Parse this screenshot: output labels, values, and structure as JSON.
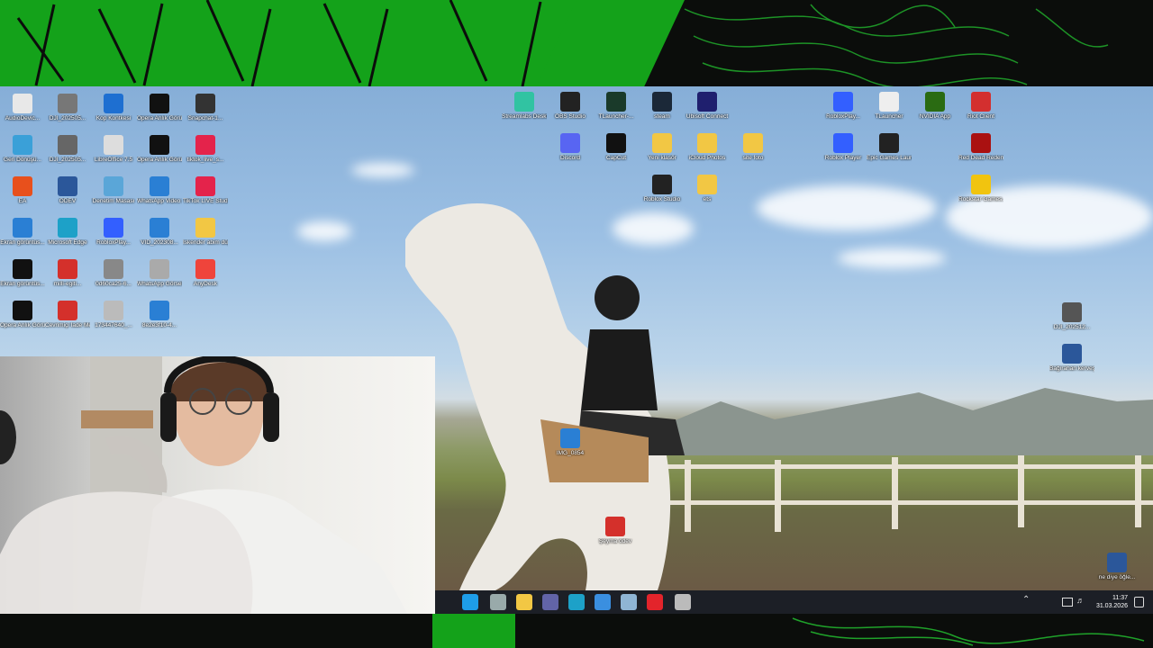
{
  "colors": {
    "accent": "#14a21a",
    "taskbar": "#1c1f26",
    "banner_dark": "#0b0d0b"
  },
  "desktop_icons_left": [
    {
      "label": "AudioDevic...",
      "icon": "audio-file-icon",
      "color": "#e8e8e8"
    },
    {
      "label": "DJI_202505...",
      "icon": "image-thumbnail-icon",
      "color": "#777"
    },
    {
      "label": "Kop Kontkesi",
      "icon": "app-icon",
      "color": "#1e6fd1"
    },
    {
      "label": "Opera Anlık Görüntü_2...",
      "icon": "screenshot-icon",
      "color": "#111"
    },
    {
      "label": "Snapchat-1...",
      "icon": "image-thumbnail-icon",
      "color": "#333"
    },
    {
      "label": "Geri Dönüşü...",
      "icon": "recycle-bin-icon",
      "color": "#3aa0d8"
    },
    {
      "label": "DJI_202505...",
      "icon": "image-thumbnail-icon",
      "color": "#666"
    },
    {
      "label": "LibreOffice 7.5",
      "icon": "libreoffice-icon",
      "color": "#ddd"
    },
    {
      "label": "Opera Anlık Görüntü_2...",
      "icon": "screenshot-icon",
      "color": "#111"
    },
    {
      "label": "tiktok_live_s...",
      "icon": "tiktok-icon",
      "color": "#e4234b"
    },
    {
      "label": "EA",
      "icon": "ea-icon",
      "color": "#e8501c"
    },
    {
      "label": "ÖDEV",
      "icon": "word-doc-icon",
      "color": "#2b579a"
    },
    {
      "label": "Denetim Masası",
      "icon": "control-panel-icon",
      "color": "#5aa6d8"
    },
    {
      "label": "WhatsApp Video 2024-...",
      "icon": "video-file-icon",
      "color": "#2a7fd4"
    },
    {
      "label": "TikTok LIVE Studio",
      "icon": "tiktok-live-icon",
      "color": "#e4234b"
    },
    {
      "label": "Ekran görüntüs...",
      "icon": "image-file-icon",
      "color": "#2a7fd4"
    },
    {
      "label": "Microsoft Edge",
      "icon": "edge-icon",
      "color": "#1da1c8"
    },
    {
      "label": "RobloxPlay...",
      "icon": "roblox-icon",
      "color": "#335fff"
    },
    {
      "label": "VID_202308...",
      "icon": "video-file-icon",
      "color": "#2a7fd4"
    },
    {
      "label": "İskender abim düğ...",
      "icon": "folder-icon",
      "color": "#f2c744"
    },
    {
      "label": "Ekran görüntüs...",
      "icon": "screenshot-icon",
      "color": "#111"
    },
    {
      "label": "milli-egiti...",
      "icon": "pdf-icon",
      "color": "#d4302b"
    },
    {
      "label": "0d60ca25-6...",
      "icon": "image-thumbnail-icon",
      "color": "#888"
    },
    {
      "label": "WhatsApp Görsel 2023...",
      "icon": "image-thumbnail-icon",
      "color": "#aaa"
    },
    {
      "label": "AnyDesk",
      "icon": "anydesk-icon",
      "color": "#ef443b"
    },
    {
      "label": "Opera Anlık Görüntü_20...",
      "icon": "screenshot-icon",
      "color": "#111"
    },
    {
      "label": "Cevrimiçi İade Merkezi",
      "icon": "pdf-icon",
      "color": "#d4302b"
    },
    {
      "label": "173447640_...",
      "icon": "image-thumbnail-icon",
      "color": "#bbb"
    },
    {
      "label": "8e2e3f10-4...",
      "icon": "image-thumbnail-icon",
      "color": "#2a7fd4"
    }
  ],
  "desktop_icons_center": [
    {
      "label": "Streamlabs Desktop",
      "icon": "streamlabs-icon",
      "color": "#31c3a2"
    },
    {
      "label": "OBS Studio",
      "icon": "obs-icon",
      "color": "#222"
    },
    {
      "label": "TLauncher-...",
      "icon": "tlauncher-icon",
      "color": "#1a3a2a"
    },
    {
      "label": "steam",
      "icon": "steam-icon",
      "color": "#1b2838"
    },
    {
      "label": "Ubisoft Connect",
      "icon": "ubisoft-icon",
      "color": "#1f1f6e"
    },
    {
      "label": "Discord",
      "icon": "discord-icon",
      "color": "#5865f2"
    },
    {
      "label": "CapCut",
      "icon": "capcut-icon",
      "color": "#111"
    },
    {
      "label": "Yeni klasör",
      "icon": "folder-icon",
      "color": "#f2c744"
    },
    {
      "label": "iCloud Photos",
      "icon": "folder-icon",
      "color": "#f2c744"
    },
    {
      "label": "site foto",
      "icon": "folder-icon",
      "color": "#f2c744"
    },
    {
      "label": "Roblox Studio",
      "icon": "roblox-studio-icon",
      "color": "#222"
    },
    {
      "label": "ets",
      "icon": "folder-icon",
      "color": "#f2c744"
    },
    {
      "label": "IMG_0854",
      "icon": "image-file-icon",
      "color": "#2a7fd4"
    },
    {
      "label": "Şeyma ödev",
      "icon": "pdf-icon",
      "color": "#d4302b"
    }
  ],
  "desktop_icons_right": [
    {
      "label": "RobloxPlay...",
      "icon": "roblox-icon",
      "color": "#335fff"
    },
    {
      "label": "TLauncher",
      "icon": "file-icon",
      "color": "#eee"
    },
    {
      "label": "NVIDIA App",
      "icon": "nvidia-icon",
      "color": "#2a6b12"
    },
    {
      "label": "Riot Client",
      "icon": "riot-icon",
      "color": "#d32f2f"
    },
    {
      "label": "Roblox Player",
      "icon": "roblox-icon",
      "color": "#335fff"
    },
    {
      "label": "Epic Games Launcher",
      "icon": "epic-icon",
      "color": "#222"
    },
    {
      "label": "Red Dead Redempti...",
      "icon": "rdr-icon",
      "color": "#a11"
    },
    {
      "label": "Rockstar Games...",
      "icon": "rockstar-icon",
      "color": "#f1c40f"
    },
    {
      "label": "DJI_202512...",
      "icon": "image-thumbnail-icon",
      "color": "#555"
    },
    {
      "label": "Bağırahan kerveş Te...",
      "icon": "word-doc-icon",
      "color": "#2b579a"
    },
    {
      "label": "ne diye öğle...",
      "icon": "word-doc-icon",
      "color": "#2b579a"
    }
  ],
  "taskbar": {
    "apps": [
      {
        "name": "start-button-icon",
        "color": "#1e9de8"
      },
      {
        "name": "task-view-icon",
        "color": "#9aa"
      },
      {
        "name": "file-explorer-icon",
        "color": "#f2c744"
      },
      {
        "name": "teams-icon",
        "color": "#6264a7"
      },
      {
        "name": "edge-icon",
        "color": "#1da1c8"
      },
      {
        "name": "store-icon",
        "color": "#3a8fe0"
      },
      {
        "name": "steam-icon",
        "color": "#8fb5d4"
      },
      {
        "name": "opera-icon",
        "color": "#e3242b"
      },
      {
        "name": "record-icon",
        "color": "#bbb"
      }
    ],
    "time": "11:37",
    "date": "31.03.2026"
  }
}
